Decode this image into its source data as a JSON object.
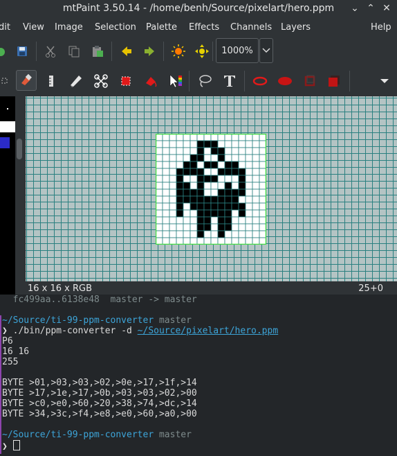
{
  "window": {
    "title": "mtPaint 3.50.14 - /home/benh/Source/pixelart/hero.ppm"
  },
  "menus": [
    "dit",
    "View",
    "Image",
    "Selection",
    "Palette",
    "Effects",
    "Channels",
    "Layers",
    "Help"
  ],
  "toolbar": {
    "zoom_value": "1000%"
  },
  "status": {
    "image_info": "16 x 16 x RGB",
    "cursor_pos": "25+0"
  },
  "image": {
    "width": 16,
    "height": 16,
    "rows": [
      "................",
      "......XXX.......",
      "......X.XX......",
      ".....XX..X......",
      "....XX.XX.XX....",
      "...XXXX..XXXX...",
      "...X..XXX...X...",
      "...XX.X...X.X...",
      "...XXXX..XXXX...",
      "...XXXXXXXXX....",
      "...X.XXXXXXXX...",
      "...X..XXXXX.X...",
      "......XX.XX.....",
      "......XX.XX.....",
      "......X..X......",
      "................"
    ],
    "colors": {
      "on": "#000000",
      "off": "#ffffff",
      "border": "#44dd44"
    }
  },
  "terminal": {
    "git_line": "  fc499aa..6138e48  master -> master",
    "prompt1_path": "~/Source/ti-99-ppm-converter",
    "prompt1_branch": "master",
    "command_prefix": "./bin/ppm-converter -d ",
    "command_link": "~/Source/pixelart/hero.ppm",
    "output": [
      "P6",
      "16 16",
      "255",
      "",
      "BYTE >01,>03,>03,>02,>0e,>17,>1f,>14",
      "BYTE >17,>1e,>17,>0b,>03,>03,>02,>00",
      "BYTE >c0,>e0,>60,>20,>38,>74,>dc,>14",
      "BYTE >34,>3c,>f4,>e8,>e0,>60,>a0,>00"
    ],
    "prompt2_path": "~/Source/ti-99-ppm-converter",
    "prompt2_branch": "master",
    "prompt_char": "❯"
  }
}
